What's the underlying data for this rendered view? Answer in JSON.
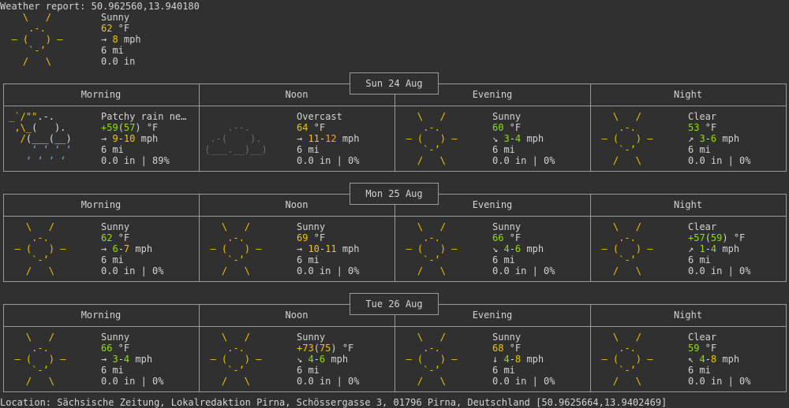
{
  "header": {
    "report_label": "Weather report: 50.962560,13.940180",
    "current": {
      "condition": "Sunny",
      "temp": "62",
      "temp_unit": " °F",
      "wind_dir": "→",
      "wind_speed": "8",
      "wind_unit": " mph",
      "visibility": "6 mi",
      "precip": "0.0 in"
    }
  },
  "period_labels": [
    "Morning",
    "Noon",
    "Evening",
    "Night"
  ],
  "days": [
    {
      "date": "Sun 24 Aug",
      "periods": [
        {
          "icon": "patchy-rain",
          "cond": "Patchy rain ne…",
          "temp": [
            {
              "t": "+59",
              "c": "grn"
            },
            {
              "t": "(",
              "c": ""
            },
            {
              "t": "57",
              "c": "grn"
            },
            {
              "t": ") °F",
              "c": ""
            }
          ],
          "wind": [
            {
              "t": "→ ",
              "c": ""
            },
            {
              "t": "9",
              "c": "ylw"
            },
            {
              "t": "-",
              "c": ""
            },
            {
              "t": "10",
              "c": "ylw"
            },
            {
              "t": " mph",
              "c": ""
            }
          ],
          "vis": "6 mi",
          "precip": "0.0 in | 89%"
        },
        {
          "icon": "overcast",
          "cond": "Overcast",
          "temp": [
            {
              "t": "64",
              "c": "ylw"
            },
            {
              "t": " °F",
              "c": ""
            }
          ],
          "wind": [
            {
              "t": "→ ",
              "c": ""
            },
            {
              "t": "11",
              "c": "ylw"
            },
            {
              "t": "-",
              "c": ""
            },
            {
              "t": "12",
              "c": "org"
            },
            {
              "t": " mph",
              "c": ""
            }
          ],
          "vis": "6 mi",
          "precip": "0.0 in | 0%"
        },
        {
          "icon": "sunny",
          "cond": "Sunny",
          "temp": [
            {
              "t": "60",
              "c": "grn"
            },
            {
              "t": " °F",
              "c": ""
            }
          ],
          "wind": [
            {
              "t": "↘ ",
              "c": ""
            },
            {
              "t": "3",
              "c": "grn"
            },
            {
              "t": "-",
              "c": ""
            },
            {
              "t": "4",
              "c": "grn"
            },
            {
              "t": " mph",
              "c": ""
            }
          ],
          "vis": "6 mi",
          "precip": "0.0 in | 0%"
        },
        {
          "icon": "clear",
          "cond": "Clear",
          "temp": [
            {
              "t": "53",
              "c": "grn"
            },
            {
              "t": " °F",
              "c": ""
            }
          ],
          "wind": [
            {
              "t": "↗ ",
              "c": ""
            },
            {
              "t": "3",
              "c": "grn"
            },
            {
              "t": "-",
              "c": ""
            },
            {
              "t": "6",
              "c": "grn"
            },
            {
              "t": " mph",
              "c": ""
            }
          ],
          "vis": "6 mi",
          "precip": "0.0 in | 0%"
        }
      ]
    },
    {
      "date": "Mon 25 Aug",
      "periods": [
        {
          "icon": "sunny",
          "cond": "Sunny",
          "temp": [
            {
              "t": "62",
              "c": "grn"
            },
            {
              "t": " °F",
              "c": ""
            }
          ],
          "wind": [
            {
              "t": "→ ",
              "c": ""
            },
            {
              "t": "6",
              "c": "grn"
            },
            {
              "t": "-",
              "c": ""
            },
            {
              "t": "7",
              "c": "ylw"
            },
            {
              "t": " mph",
              "c": ""
            }
          ],
          "vis": "6 mi",
          "precip": "0.0 in | 0%"
        },
        {
          "icon": "sunny",
          "cond": "Sunny",
          "temp": [
            {
              "t": "69",
              "c": "ylw"
            },
            {
              "t": " °F",
              "c": ""
            }
          ],
          "wind": [
            {
              "t": "→ ",
              "c": ""
            },
            {
              "t": "10",
              "c": "ylw"
            },
            {
              "t": "-",
              "c": ""
            },
            {
              "t": "11",
              "c": "ylw"
            },
            {
              "t": " mph",
              "c": ""
            }
          ],
          "vis": "6 mi",
          "precip": "0.0 in | 0%"
        },
        {
          "icon": "sunny",
          "cond": "Sunny",
          "temp": [
            {
              "t": "66",
              "c": "grn"
            },
            {
              "t": " °F",
              "c": ""
            }
          ],
          "wind": [
            {
              "t": "↘ ",
              "c": ""
            },
            {
              "t": "4",
              "c": "grn"
            },
            {
              "t": "-",
              "c": ""
            },
            {
              "t": "6",
              "c": "grn"
            },
            {
              "t": " mph",
              "c": ""
            }
          ],
          "vis": "6 mi",
          "precip": "0.0 in | 0%"
        },
        {
          "icon": "clear",
          "cond": "Clear",
          "temp": [
            {
              "t": "+57",
              "c": "grn"
            },
            {
              "t": "(",
              "c": ""
            },
            {
              "t": "59",
              "c": "grn"
            },
            {
              "t": ") °F",
              "c": ""
            }
          ],
          "wind": [
            {
              "t": "↗ ",
              "c": ""
            },
            {
              "t": "1",
              "c": "grn"
            },
            {
              "t": "-",
              "c": ""
            },
            {
              "t": "4",
              "c": "grn"
            },
            {
              "t": " mph",
              "c": ""
            }
          ],
          "vis": "6 mi",
          "precip": "0.0 in | 0%"
        }
      ]
    },
    {
      "date": "Tue 26 Aug",
      "periods": [
        {
          "icon": "sunny",
          "cond": "Sunny",
          "temp": [
            {
              "t": "66",
              "c": "grn"
            },
            {
              "t": " °F",
              "c": ""
            }
          ],
          "wind": [
            {
              "t": "→ ",
              "c": ""
            },
            {
              "t": "3",
              "c": "grn"
            },
            {
              "t": "-",
              "c": ""
            },
            {
              "t": "4",
              "c": "grn"
            },
            {
              "t": " mph",
              "c": ""
            }
          ],
          "vis": "6 mi",
          "precip": "0.0 in | 0%"
        },
        {
          "icon": "sunny",
          "cond": "Sunny",
          "temp": [
            {
              "t": "+73",
              "c": "ylw"
            },
            {
              "t": "(",
              "c": ""
            },
            {
              "t": "75",
              "c": "ylw"
            },
            {
              "t": ") °F",
              "c": ""
            }
          ],
          "wind": [
            {
              "t": "↘ ",
              "c": ""
            },
            {
              "t": "4",
              "c": "grn"
            },
            {
              "t": "-",
              "c": ""
            },
            {
              "t": "6",
              "c": "grn"
            },
            {
              "t": " mph",
              "c": ""
            }
          ],
          "vis": "6 mi",
          "precip": "0.0 in | 0%"
        },
        {
          "icon": "sunny",
          "cond": "Sunny",
          "temp": [
            {
              "t": "68",
              "c": "ylw"
            },
            {
              "t": " °F",
              "c": ""
            }
          ],
          "wind": [
            {
              "t": "↓ ",
              "c": ""
            },
            {
              "t": "4",
              "c": "grn"
            },
            {
              "t": "-",
              "c": ""
            },
            {
              "t": "8",
              "c": "ylw"
            },
            {
              "t": " mph",
              "c": ""
            }
          ],
          "vis": "6 mi",
          "precip": "0.0 in | 0%"
        },
        {
          "icon": "clear",
          "cond": "Clear",
          "temp": [
            {
              "t": "59",
              "c": "grn"
            },
            {
              "t": " °F",
              "c": ""
            }
          ],
          "wind": [
            {
              "t": "↖ ",
              "c": ""
            },
            {
              "t": "4",
              "c": "grn"
            },
            {
              "t": "-",
              "c": ""
            },
            {
              "t": "8",
              "c": "ylw"
            },
            {
              "t": " mph",
              "c": ""
            }
          ],
          "vis": "6 mi",
          "precip": "0.0 in | 0%"
        }
      ]
    }
  ],
  "footer": {
    "location": "Location: Sächsische Zeitung, Lokalredaktion Pirna, Schössergasse 3, 01796 Pirna, Deutschland [50.9625664,13.9402469]"
  },
  "colors": {
    "background": "#303030",
    "text": "#d3d3d3",
    "sun": "#f2c500",
    "temp_mild": "#8fe000",
    "wind_high": "#f5a623",
    "cloud_dim": "#6c6c6c",
    "rain": "#7aa6d8",
    "border": "#9a9a9a"
  }
}
